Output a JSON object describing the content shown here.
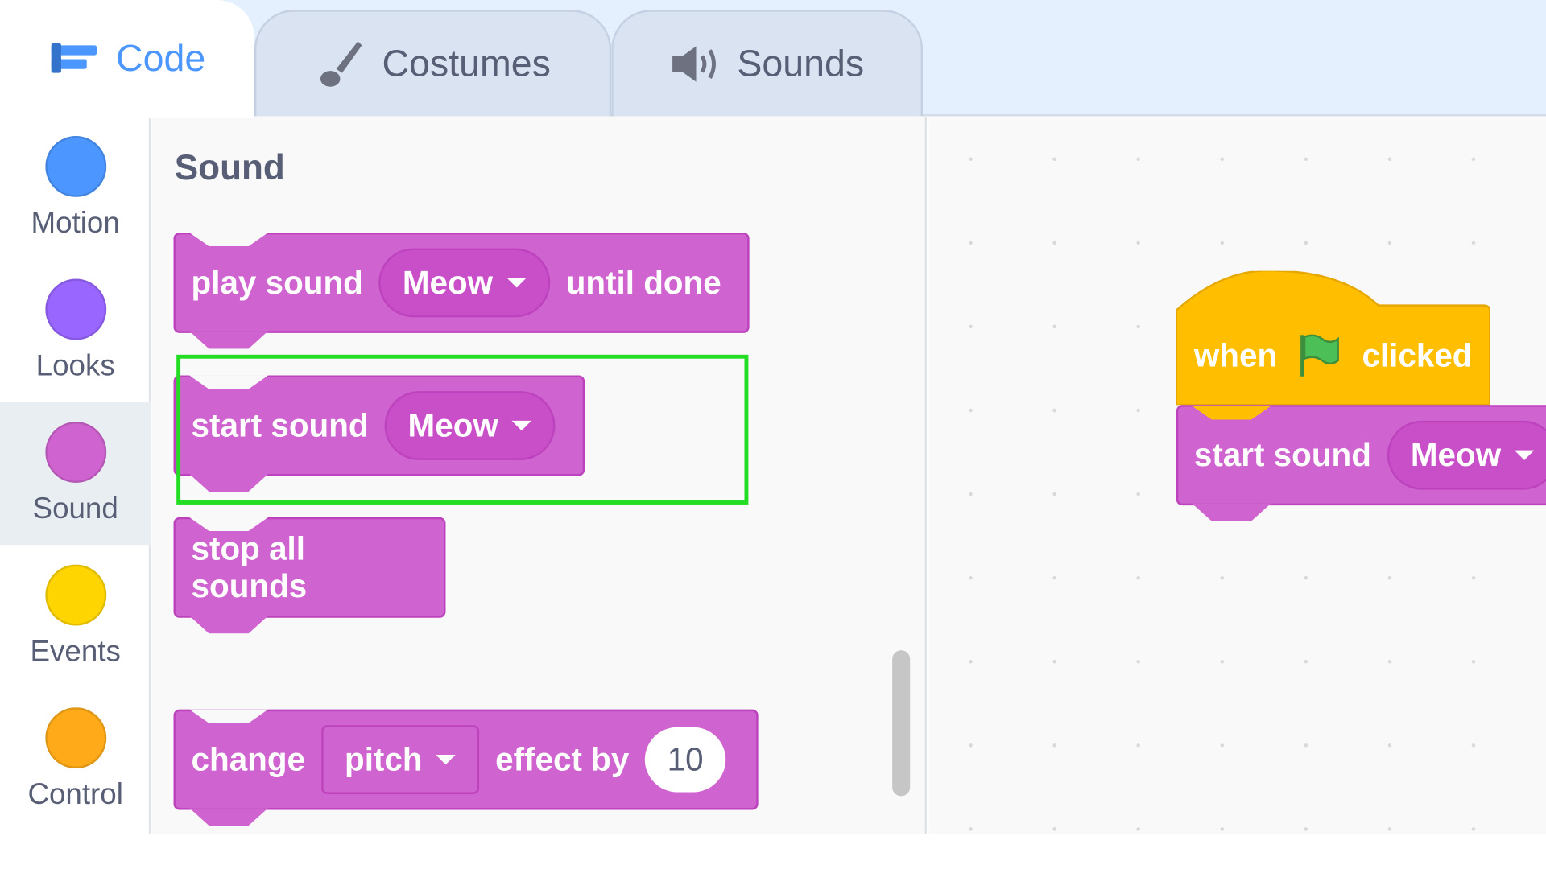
{
  "tabs": [
    {
      "label": "Code",
      "icon": "code-icon"
    },
    {
      "label": "Costumes",
      "icon": "brush-icon"
    },
    {
      "label": "Sounds",
      "icon": "speaker-icon"
    }
  ],
  "categories": [
    {
      "label": "Motion",
      "color": "#4c97ff"
    },
    {
      "label": "Looks",
      "color": "#9966ff"
    },
    {
      "label": "Sound",
      "color": "#cf63cf",
      "selected": true
    },
    {
      "label": "Events",
      "color": "#ffd500"
    },
    {
      "label": "Control",
      "color": "#ffab19"
    }
  ],
  "palette": {
    "heading": "Sound",
    "play_sound": {
      "text1": "play sound",
      "menu": "Meow",
      "text2": "until done"
    },
    "start_sound": {
      "text1": "start sound",
      "menu": "Meow"
    },
    "stop_all": {
      "text": "stop all sounds"
    },
    "change_effect": {
      "text1": "change",
      "menu": "pitch",
      "text2": "effect by",
      "value": "10"
    }
  },
  "workspace": {
    "hat": {
      "text1": "when",
      "icon": "green-flag-icon",
      "text2": "clicked"
    },
    "start_sound": {
      "text1": "start sound",
      "menu": "Meow"
    }
  },
  "colors": {
    "sound": "#cf63cf",
    "events": "#ffbf00",
    "highlight": "#22dd22",
    "accent": "#4c97ff"
  }
}
